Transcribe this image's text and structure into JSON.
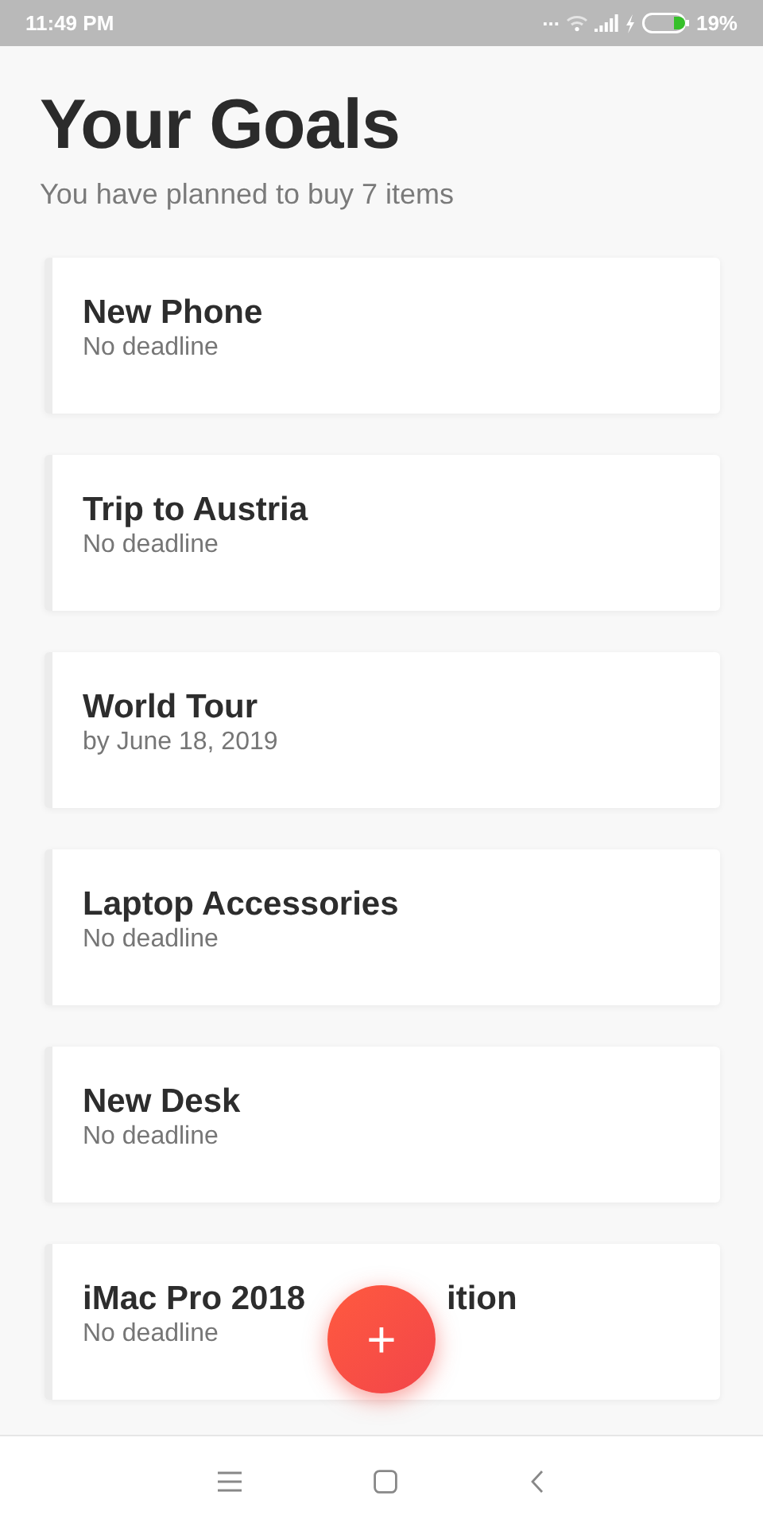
{
  "status_bar": {
    "time": "11:49 PM",
    "dots": "...",
    "battery": "19%"
  },
  "header": {
    "title": "Your Goals",
    "subtitle": "You have planned to buy 7 items"
  },
  "goals": [
    {
      "name": "New Phone",
      "deadline": "No deadline"
    },
    {
      "name": "Trip to Austria",
      "deadline": "No deadline"
    },
    {
      "name": "World Tour",
      "deadline": "by June 18, 2019"
    },
    {
      "name": "Laptop Accessories",
      "deadline": "No deadline"
    },
    {
      "name": "New Desk",
      "deadline": "No deadline"
    },
    {
      "name": "iMac Pro 2018",
      "name_after_button": "ition",
      "deadline": "No deadline"
    }
  ],
  "fab": {
    "label": "+"
  }
}
